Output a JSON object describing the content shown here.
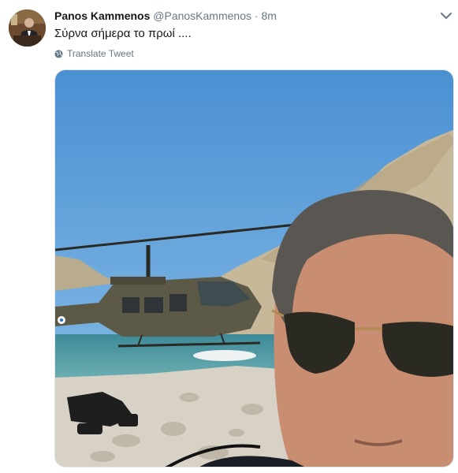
{
  "tweet": {
    "author_name": "Panos Kammenos",
    "author_handle": "@PanosKammenos",
    "separator": "·",
    "timestamp": "8m",
    "text": "Σύρνα σήμερα το πρωί ....",
    "translate_label": "Translate Tweet"
  },
  "icons": {
    "menu": "chevron-down-icon",
    "translate": "globe-icon"
  },
  "colors": {
    "name": "#14171a",
    "secondary": "#657786",
    "border": "#e1e8ed"
  }
}
